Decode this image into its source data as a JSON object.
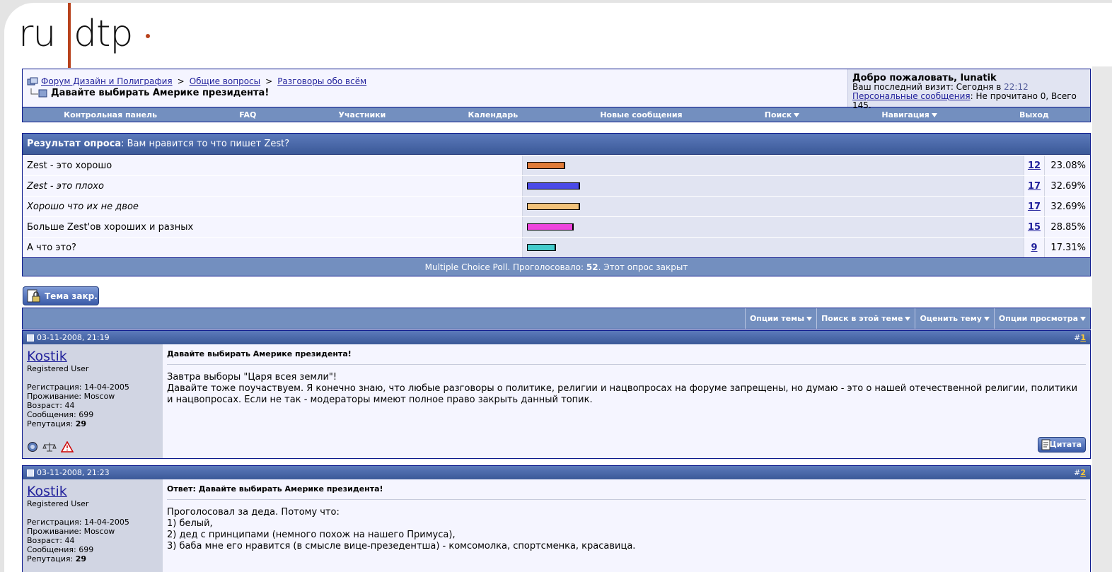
{
  "logo": {
    "left": "ru",
    "right": "dtp"
  },
  "breadcrumb": {
    "items": [
      "Форум Дизайн и Полиграфия",
      "Общие вопросы",
      "Разговоры обо всём"
    ],
    "separator": ">",
    "current": "Давайте выбирать Америке президента!"
  },
  "welcome": {
    "greeting": "Добро пожаловать, lunatik",
    "last_visit_label": "Ваш последний визит: Сегодня в",
    "last_visit_time": "22:12",
    "pm_link": "Персональные сообщения",
    "pm_status": ": Не прочитано 0, Всего 145."
  },
  "menu": {
    "items": [
      "Контрольная панель",
      "FAQ",
      "Участники",
      "Календарь",
      "Новые сообщения",
      "Поиск",
      "Навигация",
      "Выход"
    ]
  },
  "poll": {
    "header_bold": "Результат опроса",
    "header_question": ": Вам нравится то что пишет Zest?",
    "options": [
      {
        "label": "Zest - это хорошо",
        "count": "12",
        "percent": "23.08%",
        "value": 23.08,
        "color": "#e07b39",
        "italic": false
      },
      {
        "label": "Zest - это плохо",
        "count": "17",
        "percent": "32.69%",
        "value": 32.69,
        "color": "#4a4ae8",
        "italic": true
      },
      {
        "label": "Хорошо что их не двое",
        "count": "17",
        "percent": "32.69%",
        "value": 32.69,
        "color": "#f2c27a",
        "italic": true
      },
      {
        "label": "Больше Zest'ов хороших и разных",
        "count": "15",
        "percent": "28.85%",
        "value": 28.85,
        "color": "#ee44dd",
        "italic": false
      },
      {
        "label": "А что это?",
        "count": "9",
        "percent": "17.31%",
        "value": 17.31,
        "color": "#44cccc",
        "italic": false
      }
    ],
    "footer_prefix": "Multiple Choice Poll. Проголосовало: ",
    "footer_votes": "52",
    "footer_suffix": ". Этот опрос закрыт"
  },
  "closed_button": {
    "label": "Тема закр."
  },
  "topic_options": [
    "Опции темы",
    "Поиск в этой теме",
    "Оценить тему",
    "Опции просмотра"
  ],
  "posts": [
    {
      "date": "03-11-2008, 21:19",
      "num_prefix": "#",
      "num": "1",
      "username": "Kostik",
      "role": "Registered User",
      "reg": "Регистрация: 14-04-2005",
      "location": "Проживание: Moscow",
      "age": "Возраст: 44",
      "messages": "Сообщения: 699",
      "rep_label": "Репутация:",
      "rep_value": "29",
      "title": "Давайте выбирать Америке президента!",
      "lines": [
        "Завтра выборы \"Царя всея земли\"!",
        "Давайте тоже поучаствуем. Я конечно знаю, что любые разговоры о политике, религии и нацвопросах на форуме запрещены, но думаю - это о нашей отечественной религии, политики и нацвопросах. Если не так - модераторы ммеют полное право закрыть данный топик."
      ],
      "quote": "Цитата"
    },
    {
      "date": "03-11-2008, 21:23",
      "num_prefix": "#",
      "num": "2",
      "username": "Kostik",
      "role": "Registered User",
      "reg": "Регистрация: 14-04-2005",
      "location": "Проживание: Moscow",
      "age": "Возраст: 44",
      "messages": "Сообщения: 699",
      "rep_label": "Репутация:",
      "rep_value": "29",
      "title": "Ответ: Давайте выбирать Америке президента!",
      "lines": [
        "Проголосовал за деда. Потому что:",
        "1) белый,",
        "2) дед с принципами (немного похож на нашего Примуса),",
        "3) баба мне его нравится (в смысле вице-презедентша) - комсомолка, спортсменка, красавица."
      ]
    }
  ]
}
